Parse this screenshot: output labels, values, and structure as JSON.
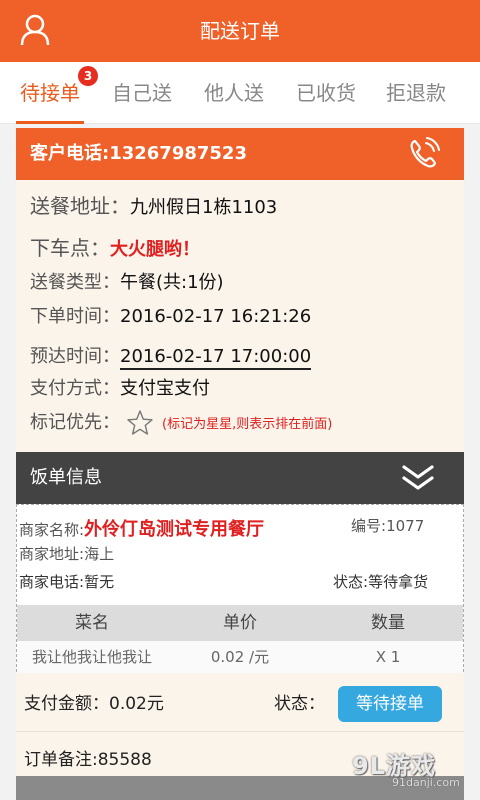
{
  "header": {
    "title": "配送订单"
  },
  "tabs": [
    {
      "label": "待接单",
      "badge": "3"
    },
    {
      "label": "自己送"
    },
    {
      "label": "他人送"
    },
    {
      "label": "已收货"
    },
    {
      "label": "拒退款"
    }
  ],
  "customer": {
    "phone_label": "客户电话:",
    "phone": "13267987523"
  },
  "details": {
    "address_label": "送餐地址：",
    "address": "九州假日1栋1103",
    "stop_label": "下车点：",
    "stop": "大火腿哟！",
    "type_label": "送餐类型：",
    "type": "午餐(共:1份)",
    "order_time_label": "下单时间：",
    "order_time": "2016-02-17 16:21:26",
    "eta_label": "预达时间：",
    "eta": "2016-02-17 17:00:00",
    "pay_method_label": "支付方式：",
    "pay_method": "支付宝支付",
    "priority_label": "标记优先：",
    "priority_hint": "(标记为星星,则表示排在前面)"
  },
  "order_info": {
    "title": "饭单信息",
    "merchant_name_label": "商家名称:",
    "merchant_name": "外伶仃岛测试专用餐厅",
    "number_label": "编号:",
    "number": "1077",
    "merchant_address_label": "商家地址:",
    "merchant_address": "海上",
    "merchant_phone_label": "商家电话:",
    "merchant_phone": "暂无",
    "status_label": "状态:",
    "status": "等待拿货",
    "columns": [
      "菜名",
      "单价",
      "数量"
    ],
    "items": [
      {
        "name": "我让他我让他我让",
        "price": "0.02 /元",
        "qty": "X 1"
      }
    ]
  },
  "payment": {
    "amount_label": "支付金额：",
    "amount": "0.02元",
    "status_label": "状态：",
    "status_button": "等待接单"
  },
  "remark": {
    "label": "订单备注:",
    "value": "85588"
  },
  "watermark": {
    "main": "9L游戏",
    "sub": "91danji.com"
  },
  "colors": {
    "brand": "#f0612a",
    "dark_header": "#434343",
    "status_button": "#35a8e0",
    "accent_red": "#e02020"
  }
}
